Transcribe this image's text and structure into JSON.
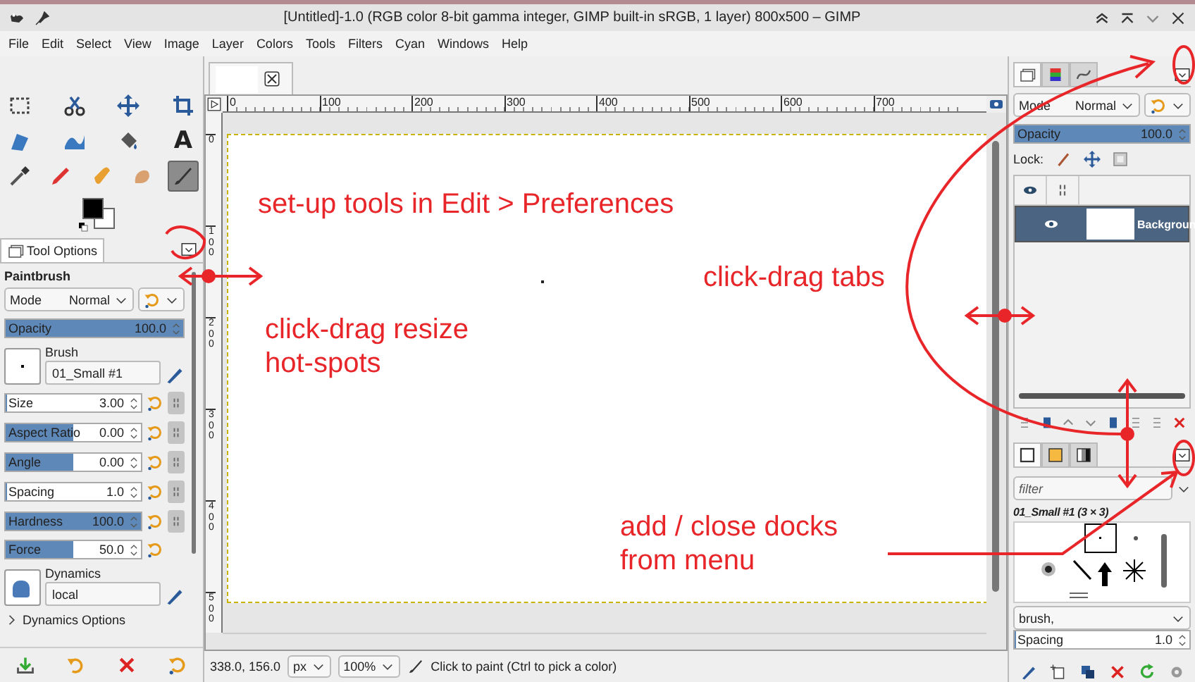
{
  "window": {
    "title": "[Untitled]-1.0 (RGB color 8-bit gamma integer, GIMP built-in sRGB, 1 layer) 800x500 – GIMP"
  },
  "menu": [
    "File",
    "Edit",
    "Select",
    "View",
    "Image",
    "Layer",
    "Colors",
    "Tools",
    "Filters",
    "Cyan",
    "Windows",
    "Help"
  ],
  "toolbox": {
    "rows": [
      [
        {
          "kind": "rect-select",
          "selected": false
        },
        {
          "kind": "scissors",
          "selected": false
        },
        {
          "kind": "move",
          "selected": false
        },
        {
          "kind": "crop",
          "selected": false
        }
      ],
      [
        {
          "kind": "transform",
          "selected": false
        },
        {
          "kind": "warp",
          "selected": false
        },
        {
          "kind": "bucket",
          "selected": false
        },
        {
          "kind": "text",
          "label": "A",
          "selected": false
        }
      ],
      [
        {
          "kind": "eyedropper",
          "selected": false
        },
        {
          "kind": "pencil",
          "selected": false
        },
        {
          "kind": "bandage",
          "selected": false
        },
        {
          "kind": "smudge",
          "selected": false
        },
        {
          "kind": "paintbrush",
          "selected": true
        }
      ]
    ]
  },
  "tool_options": {
    "tab": "Tool Options",
    "tool": "Paintbrush",
    "mode": {
      "label": "Mode",
      "value": "Normal"
    },
    "opacity": {
      "label": "Opacity",
      "value": "100.0",
      "level": 1
    },
    "brush": {
      "label": "Brush",
      "value": "01_Small #1"
    },
    "sliders": [
      {
        "label": "Size",
        "value": "3.00",
        "level": 0,
        "chain": true
      },
      {
        "label": "Aspect Ratio",
        "value": "0.00",
        "level": 0.5,
        "chain": true
      },
      {
        "label": "Angle",
        "value": "0.00",
        "level": 0.5,
        "chain": true
      },
      {
        "label": "Spacing",
        "value": "1.0",
        "level": 0,
        "chain": true
      },
      {
        "label": "Hardness",
        "value": "100.0",
        "level": 1,
        "chain": true
      },
      {
        "label": "Force",
        "value": "50.0",
        "level": 0.5,
        "chain": false
      }
    ],
    "dynamics": {
      "label": "Dynamics",
      "value": "local"
    },
    "dynamics_options": {
      "label": "Dynamics Options",
      "expanded": false
    }
  },
  "canvas": {
    "h_ruler": [
      "0",
      "100",
      "200",
      "300",
      "400",
      "500",
      "600",
      "700"
    ],
    "v_ruler": [
      "0",
      "100",
      "200",
      "300",
      "400",
      "500"
    ]
  },
  "status": {
    "coords": "338.0, 156.0",
    "unit": "px",
    "zoom": "100%",
    "message": "Click to paint (Ctrl to pick a color)"
  },
  "layers_dock": {
    "tabs": [
      {
        "kind": "layers",
        "selected": true
      },
      {
        "kind": "channels",
        "selected": false
      },
      {
        "kind": "paths",
        "selected": false
      }
    ],
    "mode": {
      "label": "Mode",
      "value": "Normal"
    },
    "opacity": {
      "label": "Opacity",
      "value": "100.0",
      "level": 1
    },
    "lock_label": "Lock:",
    "layers": [
      {
        "name": "Backgroun",
        "visible": true,
        "selected": true
      }
    ]
  },
  "brushes_dock": {
    "tabs": [
      {
        "kind": "brushes",
        "selected": true
      },
      {
        "kind": "patterns",
        "selected": false
      },
      {
        "kind": "gradients",
        "selected": false
      }
    ],
    "filter": {
      "placeholder": "filter"
    },
    "brush_title": "01_Small #1 (3 × 3)",
    "tag": "brush,",
    "spacing": {
      "label": "Spacing",
      "value": "1.0",
      "level": 0
    }
  },
  "annotations": [
    {
      "text": "set-up tools in Edit > Preferences"
    },
    {
      "text": "click-drag tabs"
    },
    {
      "text": "click-drag resize hot-spots"
    },
    {
      "text": "add / close docks from menu"
    }
  ]
}
